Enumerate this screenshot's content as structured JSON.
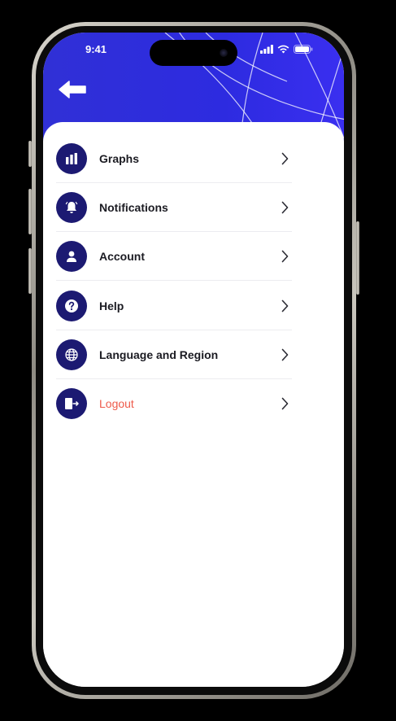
{
  "status_bar": {
    "time": "9:41"
  },
  "colors": {
    "header_blue": "#3030d6",
    "icon_circle": "#1c1a72",
    "logout_red": "#ee5a4a"
  },
  "header": {
    "back_icon": "arrow-left-icon"
  },
  "menu": {
    "items": [
      {
        "label": "Graphs",
        "icon": "bar-chart-icon"
      },
      {
        "label": "Notifications",
        "icon": "bell-icon"
      },
      {
        "label": "Account",
        "icon": "user-icon"
      },
      {
        "label": "Help",
        "icon": "question-icon"
      },
      {
        "label": "Language and Region",
        "icon": "globe-icon"
      },
      {
        "label": "Logout",
        "icon": "logout-icon"
      }
    ]
  }
}
